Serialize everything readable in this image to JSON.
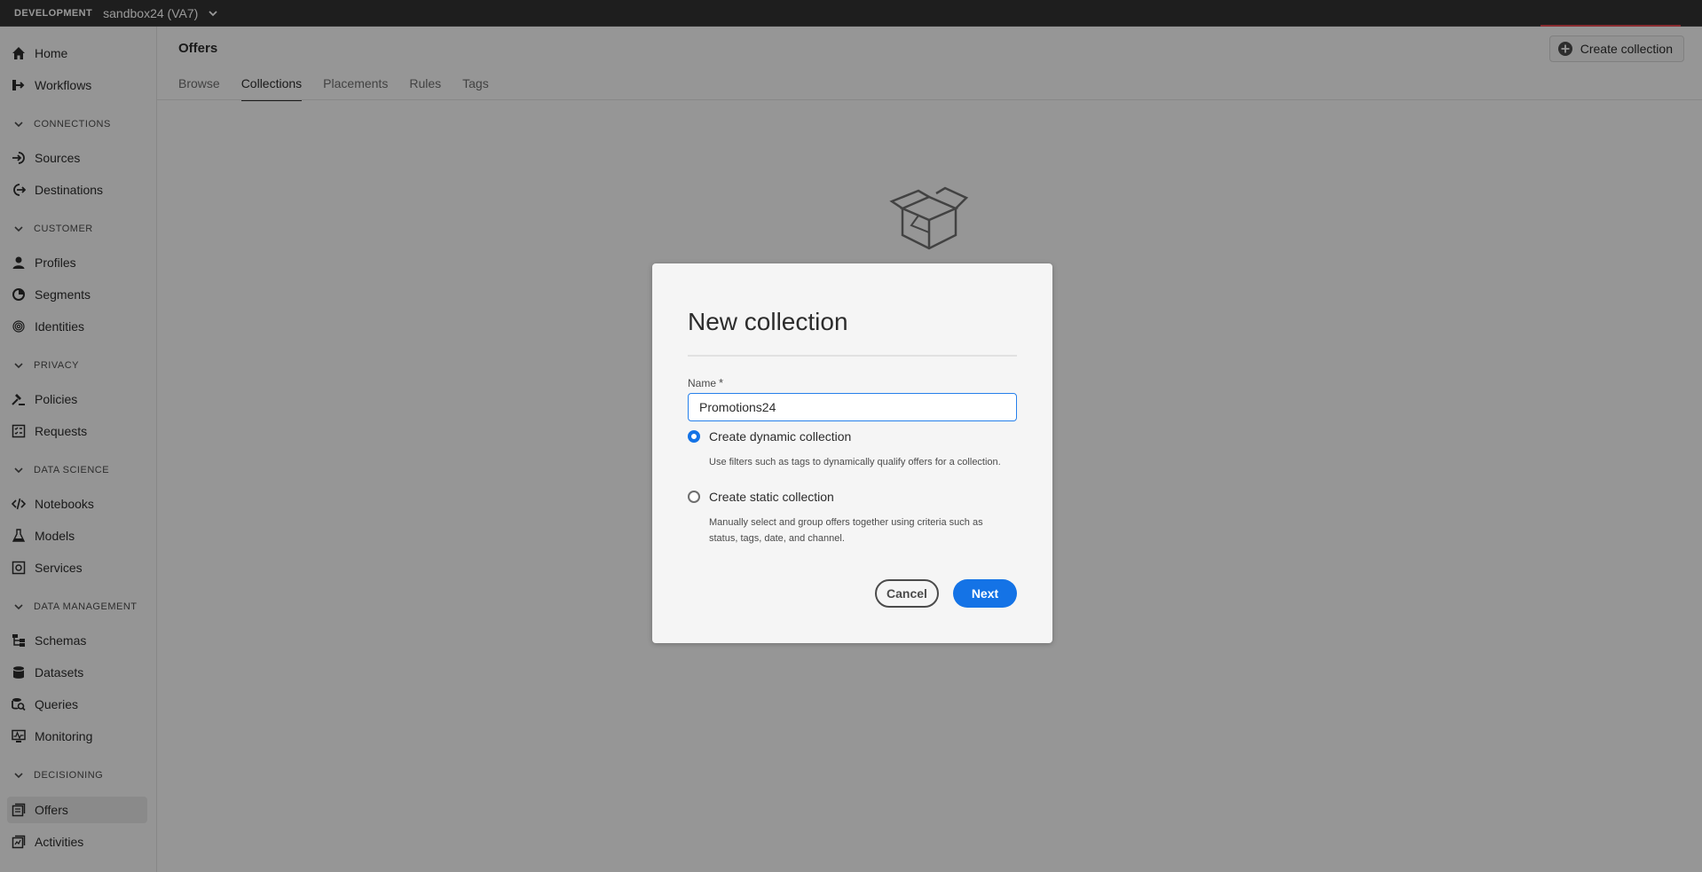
{
  "topbar": {
    "environment": "DEVELOPMENT",
    "sandbox": "sandbox24 (VA7)"
  },
  "sidebar": {
    "items": [
      {
        "label": "Home",
        "icon": "home-icon"
      },
      {
        "label": "Workflows",
        "icon": "workflow-icon"
      },
      {
        "section": "CONNECTIONS"
      },
      {
        "label": "Sources",
        "icon": "sources-icon"
      },
      {
        "label": "Destinations",
        "icon": "destinations-icon"
      },
      {
        "section": "CUSTOMER"
      },
      {
        "label": "Profiles",
        "icon": "user-icon"
      },
      {
        "label": "Segments",
        "icon": "segments-icon"
      },
      {
        "label": "Identities",
        "icon": "fingerprint-icon"
      },
      {
        "section": "PRIVACY"
      },
      {
        "label": "Policies",
        "icon": "gavel-icon"
      },
      {
        "label": "Requests",
        "icon": "checklist-icon"
      },
      {
        "section": "DATA SCIENCE"
      },
      {
        "label": "Notebooks",
        "icon": "code-icon"
      },
      {
        "label": "Models",
        "icon": "flask-icon"
      },
      {
        "label": "Services",
        "icon": "gear-icon"
      },
      {
        "section": "DATA MANAGEMENT"
      },
      {
        "label": "Schemas",
        "icon": "schema-icon"
      },
      {
        "label": "Datasets",
        "icon": "database-icon"
      },
      {
        "label": "Queries",
        "icon": "query-icon"
      },
      {
        "label": "Monitoring",
        "icon": "monitoring-icon"
      },
      {
        "section": "DECISIONING"
      },
      {
        "label": "Offers",
        "icon": "offers-icon",
        "active": true
      },
      {
        "label": "Activities",
        "icon": "activities-icon"
      }
    ]
  },
  "main": {
    "title": "Offers",
    "create_button": "Create collection",
    "tabs": [
      "Browse",
      "Collections",
      "Placements",
      "Rules",
      "Tags"
    ],
    "active_tab": "Collections"
  },
  "dialog": {
    "title": "New collection",
    "name_label": "Name",
    "required_mark": "*",
    "name_value": "Promotions24",
    "options": [
      {
        "label": "Create dynamic collection",
        "description": "Use filters such as tags to dynamically qualify offers for a collection.",
        "checked": true
      },
      {
        "label": "Create static collection",
        "description": "Manually select and group offers together using criteria such as status, tags, date, and channel.",
        "checked": false
      }
    ],
    "cancel_label": "Cancel",
    "next_label": "Next"
  },
  "colors": {
    "accent": "#1473e6",
    "topbar": "#323232",
    "focus_border": "#2680eb"
  }
}
